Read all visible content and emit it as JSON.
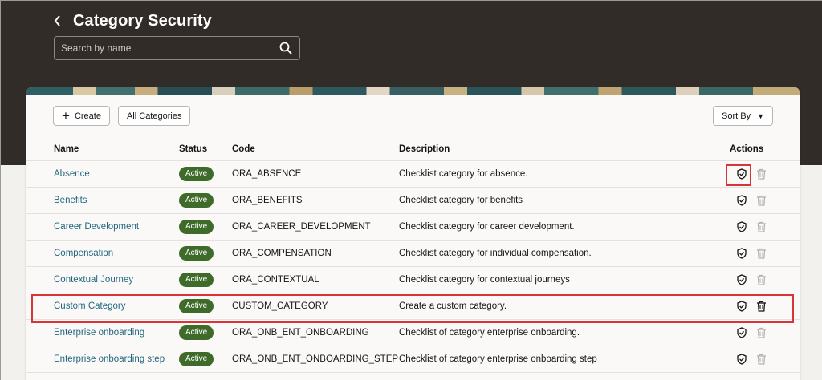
{
  "header": {
    "title": "Category Security",
    "back_icon": "chevron-left-icon"
  },
  "search": {
    "placeholder": "Search by name",
    "value": "",
    "icon": "search-icon"
  },
  "toolbar": {
    "create_label": "Create",
    "all_categories_label": "All Categories",
    "sort_label": "Sort By"
  },
  "table": {
    "columns": [
      "Name",
      "Status",
      "Code",
      "Description",
      "Actions"
    ],
    "rows": [
      {
        "name": "Absence",
        "status": "Active",
        "code": "ORA_ABSENCE",
        "description": "Checklist category for absence."
      },
      {
        "name": "Benefits",
        "status": "Active",
        "code": "ORA_BENEFITS",
        "description": "Checklist category for benefits"
      },
      {
        "name": "Career Development",
        "status": "Active",
        "code": "ORA_CAREER_DEVELOPMENT",
        "description": "Checklist category for career development."
      },
      {
        "name": "Compensation",
        "status": "Active",
        "code": "ORA_COMPENSATION",
        "description": "Checklist category for individual compensation."
      },
      {
        "name": "Contextual Journey",
        "status": "Active",
        "code": "ORA_CONTEXTUAL",
        "description": "Checklist category for contextual journeys"
      },
      {
        "name": "Custom Category",
        "status": "Active",
        "code": "CUSTOM_CATEGORY",
        "description": "Create a custom category."
      },
      {
        "name": "Enterprise onboarding",
        "status": "Active",
        "code": "ORA_ONB_ENT_ONBOARDING",
        "description": "Checklist of category enterprise onboarding."
      },
      {
        "name": "Enterprise onboarding step",
        "status": "Active",
        "code": "ORA_ONB_ENT_ONBOARDING_STEP",
        "description": "Checklist of category enterprise onboarding step"
      }
    ]
  },
  "colors": {
    "header_bg": "#322c28",
    "link": "#22677f",
    "active_badge": "#3e6b29",
    "highlight": "#d9343a",
    "delete_disabled": "#b5b0ab",
    "delete_enabled": "#161513"
  }
}
